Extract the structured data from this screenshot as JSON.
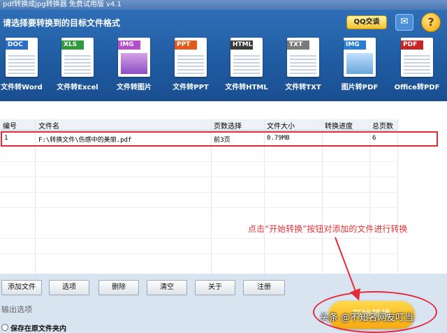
{
  "window": {
    "title": "pdf转换成jpg转换器 免费试用版 v4.1"
  },
  "header": {
    "prompt": "请选择要转换到的目标文件格式",
    "qq_label": "QQ交谈",
    "chat_icon": "chat-bubble-icon",
    "help_icon": "question-icon"
  },
  "formats": [
    {
      "tag": "DOC",
      "label": "文件转Word",
      "color": "#2b6fc9"
    },
    {
      "tag": "XLS",
      "label": "文件转Excel",
      "color": "#2f9a3b"
    },
    {
      "tag": "IMG",
      "label": "文件转图片",
      "color": "#b64cc9"
    },
    {
      "tag": "PPT",
      "label": "文件转PPT",
      "color": "#e05a1d"
    },
    {
      "tag": "HTML",
      "label": "文件转HTML",
      "color": "#3a3a3a"
    },
    {
      "tag": "TXT",
      "label": "文件转TXT",
      "color": "#7a7a7a"
    },
    {
      "tag": "IMG",
      "label": "图片转PDF",
      "color": "#2a7dd0"
    },
    {
      "tag": "PDF",
      "label": "Office转PDF",
      "color": "#c72525"
    }
  ],
  "table": {
    "headers": [
      "编号",
      "文件名",
      "页数选择",
      "文件大小",
      "转换进度",
      "总页数"
    ],
    "rows": [
      {
        "id": "1",
        "filename": "F:\\转换文件\\伤感中的美丽.pdf",
        "pages": "前3页",
        "size": "0.79MB",
        "progress": "",
        "total": "6"
      }
    ]
  },
  "annotation": "点击“开始转换”按钮对添加的文件进行转换",
  "buttons": {
    "add": "添加文件",
    "options": "选项",
    "delete": "删除",
    "clear": "清空",
    "about": "关于",
    "register": "注册",
    "start": "开始转换"
  },
  "output": {
    "label": "输出选项",
    "keep_in_folder": "保存在原文件夹内"
  },
  "watermark": "头条 @不知名网友叮当",
  "colors": {
    "accent_red": "#e5283a",
    "header_blue": "#2f6fb7",
    "start_orange": "#f6a811"
  }
}
